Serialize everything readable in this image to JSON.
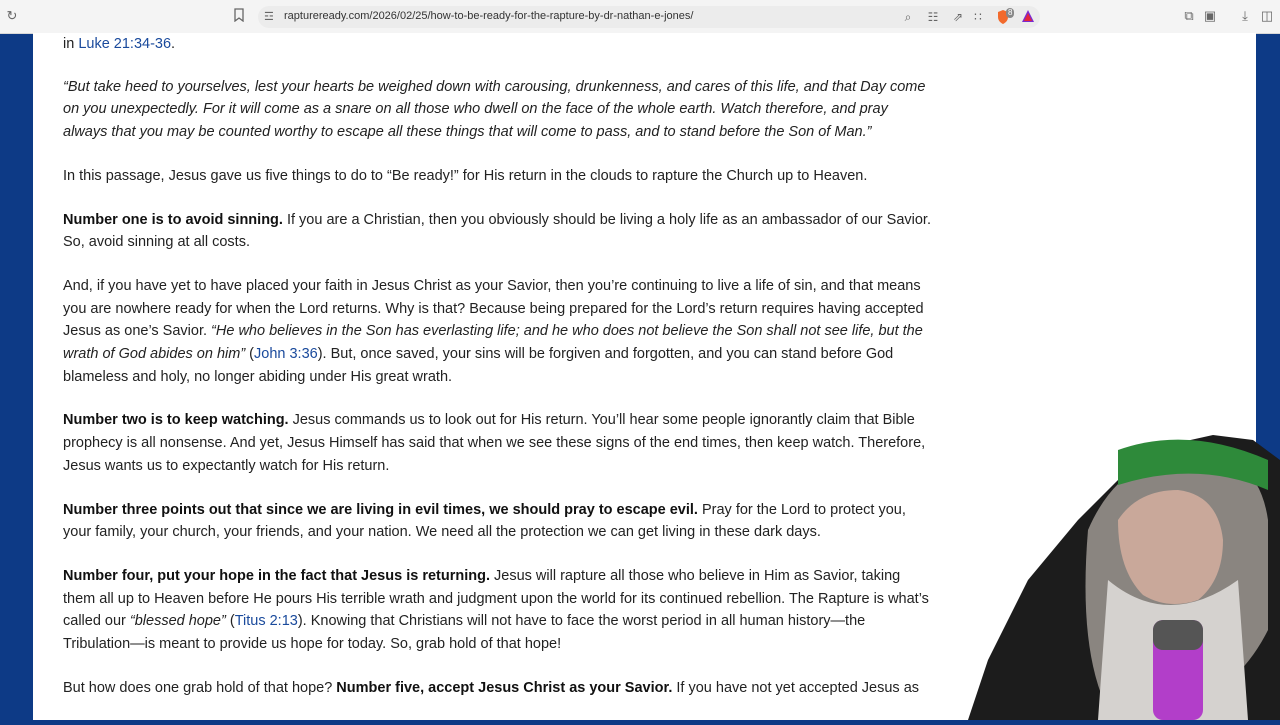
{
  "browser": {
    "url": "raptureready.com/2026/02/25/how-to-be-ready-for-the-rapture-by-dr-nathan-e-jones/",
    "icons": [
      "reload-icon",
      "bookmark-icon",
      "site-info-icon",
      "zoom-icon",
      "reader-icon",
      "share-icon",
      "rss-icon",
      "brave-shield-icon",
      "brave-rewards-icon",
      "extensions-icon",
      "sidebar-icon",
      "download-icon",
      "wallet-icon"
    ],
    "shield_badge": "8"
  },
  "article": {
    "intro_prefix": "in ",
    "intro_link": "Luke 21:34-36",
    "intro_suffix": ".",
    "quote": "“But take heed to yourselves, lest your hearts be weighed down with carousing, drunkenness, and cares of this life, and that Day come on you unexpectedly. For it will come as a snare on all those who dwell on the face of the whole earth. Watch therefore, and pray always that you may be counted worthy to escape all these things that will come to pass, and to stand before the Son of Man.”",
    "p_passage": "In this passage, Jesus gave us five things to do to “Be ready!” for His return in the clouds to rapture the Church up to Heaven.",
    "p1_bold": "Number one is to avoid sinning.",
    "p1_text": " If you are a Christian, then you obviously should be living a holy life as an ambassador of our Savior. So, avoid sinning at all costs.",
    "p_faith_text1": "And, if you have yet to have placed your faith in Jesus Christ as your Savior, then you’re continuing to live a life of sin, and that means you are nowhere ready for when the Lord returns. Why is that? Because being prepared for the Lord’s return requires having accepted Jesus as one’s Savior. ",
    "p_faith_quote": "“He who believes in the Son has everlasting life; and he who does not believe the Son shall not see life, but the wrath of God abides on him”",
    "p_faith_open": " (",
    "p_faith_link": "John 3:36",
    "p_faith_text2": "). But, once saved, your sins will be forgiven and forgotten, and you can stand before God blameless and holy, no longer abiding under His great wrath.",
    "p2_bold": "Number two is to keep watching.",
    "p2_text": " Jesus commands us to look out for His return. You’ll hear some people ignorantly claim that Bible prophecy is all nonsense. And yet, Jesus Himself has said that when we see these signs of the end times, then keep watch. Therefore, Jesus wants us to expectantly watch for His return.",
    "p3_bold": "Number three points out that since we are living in evil times, we should pray to escape evil.",
    "p3_text": " Pray for the Lord to protect you, your family, your church, your friends, and your nation. We need all the protection we can get living in these dark days.",
    "p4_bold": "Number four, put your hope in the fact that Jesus is returning.",
    "p4_text1": " Jesus will rapture all those who believe in Him as Savior, taking them all up to Heaven before He pours His terrible wrath and judgment upon the world for its continued rebellion. The Rapture is what’s called our ",
    "p4_quote": "“blessed hope”",
    "p4_open": " (",
    "p4_link": "Titus 2:13",
    "p4_text2": "). Knowing that Christians will not have to face the worst period in all human history—the Tribulation—is meant to provide us hope for today. So, grab hold of that hope!",
    "p5_text1": "But how does one grab hold of that hope? ",
    "p5_bold": "Number five, accept Jesus Christ as your Savior.",
    "p5_text2": " If you have not yet accepted Jesus as"
  }
}
